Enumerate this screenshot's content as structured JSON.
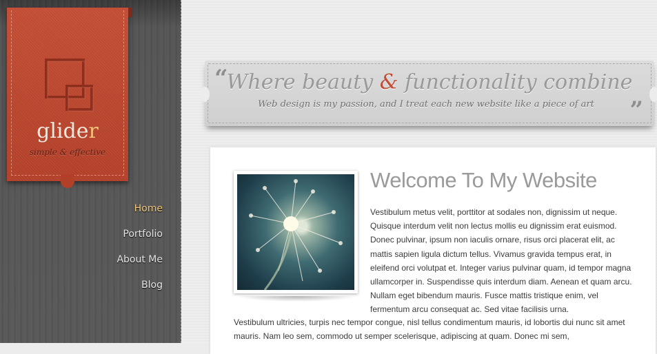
{
  "logo": {
    "word_main": "glide",
    "word_accent": "r",
    "tagline": "simple & effective"
  },
  "nav": {
    "items": [
      {
        "label": "Home",
        "active": true
      },
      {
        "label": "Portfolio",
        "active": false
      },
      {
        "label": "About Me",
        "active": false
      },
      {
        "label": "Blog",
        "active": false
      }
    ]
  },
  "banner": {
    "title_before": "Where beauty ",
    "title_amp": "&",
    "title_after": " functionality combine",
    "subtitle": "Web design is my passion, and I treat each new website like a piece of art",
    "quote_open": "“",
    "quote_close": "”"
  },
  "content": {
    "heading": "Welcome To My Website",
    "paragraph_wrapped": "Vestibulum metus velit, porttitor at sodales non, dignissim ut neque. Quisque interdum velit non lectus mollis eu dignissim erat euismod. Donec pulvinar, ipsum non iaculis ornare, risus orci placerat elit, ac mattis sapien ligula dictum tellus. Vivamus gravida tempus erat, in eleifend orci volutpat et. Integer varius pulvinar quam, id tempor magna ullamcorper in. Suspendisse quis interdum diam. Aenean et quam arcu. Nullam eget bibendum mauris. Fusce mattis tristique enim, vel fermentum arcu consequat ac. Sed vitae facilisis urna.",
    "paragraph_full": "Vestibulum ultricies, turpis nec tempor congue, nisl tellus condimentum mauris, id lobortis dui nunc sit amet mauris. Nam leo sem, commodo ut semper scelerisque, adipiscing at quam. Donec mi sem,"
  },
  "colors": {
    "accent": "#c24d35",
    "nav_active": "#f0c878",
    "sidebar": "#555555"
  }
}
